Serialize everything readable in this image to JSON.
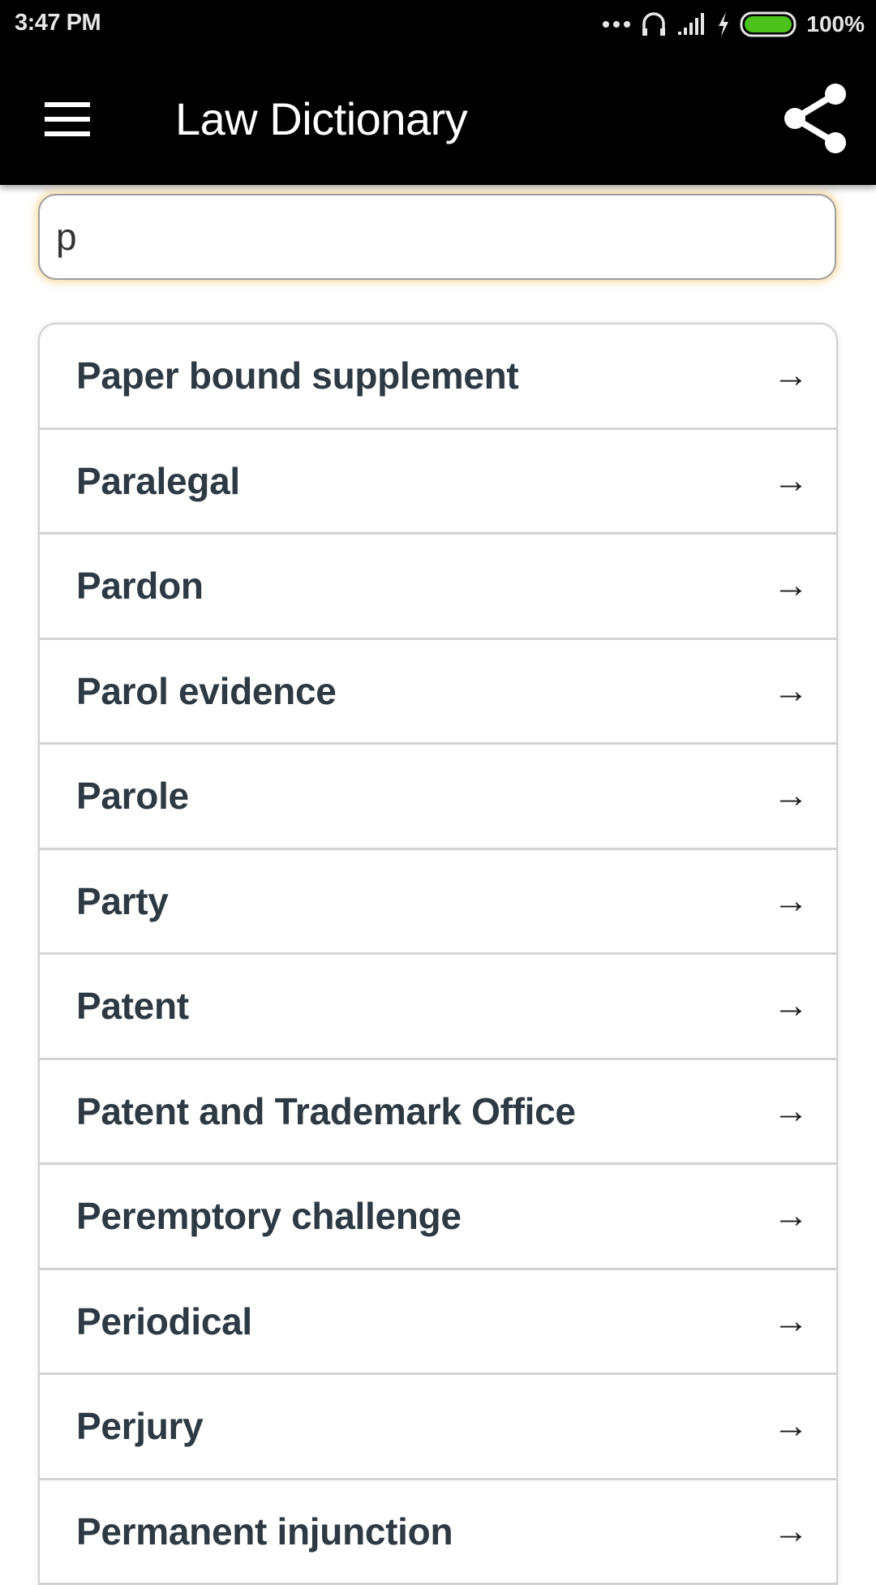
{
  "status_bar": {
    "time": "3:47 PM",
    "battery_percent": "100%",
    "battery_level": 1.0,
    "icons": [
      "more-dots-icon",
      "headset-icon",
      "signal-icon",
      "charging-icon",
      "battery-icon"
    ],
    "battery_color": "#4cc31a"
  },
  "app_bar": {
    "title": "Law Dictionary",
    "menu_icon": "hamburger-menu-icon",
    "share_icon": "share-icon"
  },
  "search": {
    "value": "p",
    "placeholder": ""
  },
  "results": {
    "arrow_glyph": "→",
    "items": [
      {
        "label": "Paper bound supplement"
      },
      {
        "label": "Paralegal"
      },
      {
        "label": "Pardon"
      },
      {
        "label": "Parol evidence"
      },
      {
        "label": "Parole"
      },
      {
        "label": "Party"
      },
      {
        "label": "Patent"
      },
      {
        "label": "Patent and Trademark Office"
      },
      {
        "label": "Peremptory challenge"
      },
      {
        "label": "Periodical"
      },
      {
        "label": "Perjury"
      },
      {
        "label": "Permanent injunction"
      }
    ]
  }
}
